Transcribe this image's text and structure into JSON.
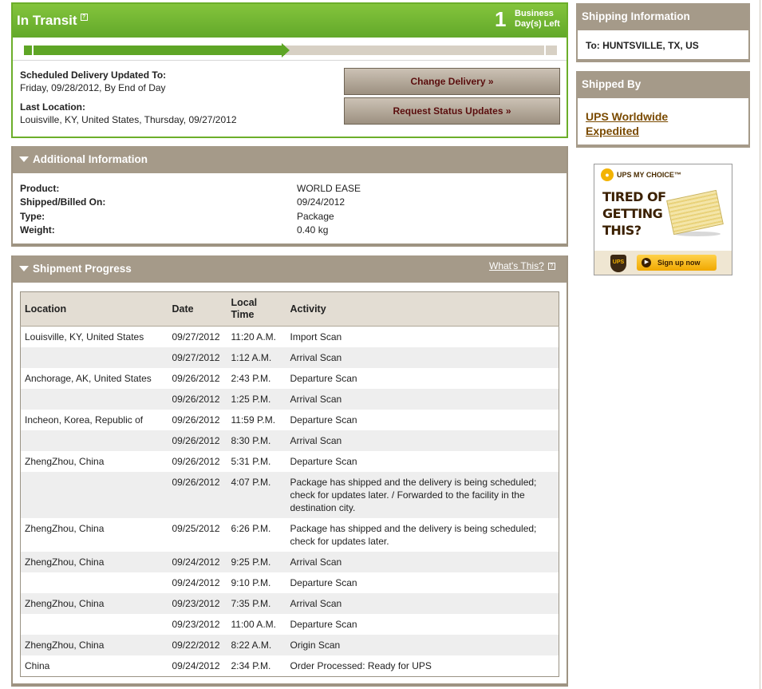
{
  "transit": {
    "title": "In Transit",
    "help_glyph": "?",
    "days_left": "1",
    "days_label_1": "Business",
    "days_label_2": "Day(s) Left",
    "progress_fraction": 0.49,
    "scheduled_label": "Scheduled Delivery Updated To:",
    "scheduled_value": "Friday, 09/28/2012, By End of Day",
    "last_location_label": "Last Location:",
    "last_location_value": "Louisville, KY, United States, Thursday, 09/27/2012",
    "change_delivery_label": "Change Delivery »",
    "request_status_label": "Request Status Updates »"
  },
  "additional_info": {
    "title": "Additional Information",
    "rows": [
      {
        "key": "Product:",
        "value": "WORLD EASE"
      },
      {
        "key": "Shipped/Billed On:",
        "value": "09/24/2012"
      },
      {
        "key": "Type:",
        "value": "Package"
      },
      {
        "key": "Weight:",
        "value": "0.40 kg"
      }
    ]
  },
  "shipment_progress": {
    "title": "Shipment Progress",
    "whats_this": "What's This?",
    "columns": [
      "Location",
      "Date",
      "Local Time",
      "Activity"
    ],
    "rows": [
      {
        "location": "Louisville, KY, United States",
        "date": "09/27/2012",
        "time": "11:20 A.M.",
        "activity": "Import Scan"
      },
      {
        "location": "",
        "date": "09/27/2012",
        "time": "1:12 A.M.",
        "activity": "Arrival Scan"
      },
      {
        "location": "Anchorage, AK, United States",
        "date": "09/26/2012",
        "time": "2:43 P.M.",
        "activity": "Departure Scan"
      },
      {
        "location": "",
        "date": "09/26/2012",
        "time": "1:25 P.M.",
        "activity": "Arrival Scan"
      },
      {
        "location": "Incheon, Korea, Republic of",
        "date": "09/26/2012",
        "time": "11:59 P.M.",
        "activity": "Departure Scan"
      },
      {
        "location": "",
        "date": "09/26/2012",
        "time": "8:30 P.M.",
        "activity": "Arrival Scan"
      },
      {
        "location": "ZhengZhou, China",
        "date": "09/26/2012",
        "time": "5:31 P.M.",
        "activity": "Departure Scan"
      },
      {
        "location": "",
        "date": "09/26/2012",
        "time": "4:07 P.M.",
        "activity": "Package has shipped and the delivery is being scheduled; check for updates later. / Forwarded to the facility in the destination city."
      },
      {
        "location": "ZhengZhou, China",
        "date": "09/25/2012",
        "time": "6:26 P.M.",
        "activity": "Package has shipped and the delivery is being scheduled; check for updates later."
      },
      {
        "location": "ZhengZhou, China",
        "date": "09/24/2012",
        "time": "9:25 P.M.",
        "activity": "Arrival Scan"
      },
      {
        "location": "",
        "date": "09/24/2012",
        "time": "9:10 P.M.",
        "activity": "Departure Scan"
      },
      {
        "location": "ZhengZhou, China",
        "date": "09/23/2012",
        "time": "7:35 P.M.",
        "activity": "Arrival Scan"
      },
      {
        "location": "",
        "date": "09/23/2012",
        "time": "11:00 A.M.",
        "activity": "Departure Scan"
      },
      {
        "location": "ZhengZhou, China",
        "date": "09/22/2012",
        "time": "8:22 A.M.",
        "activity": "Origin Scan"
      },
      {
        "location": "China",
        "date": "09/24/2012",
        "time": "2:34 P.M.",
        "activity": "Order Processed: Ready for UPS"
      }
    ]
  },
  "shipping_info": {
    "title": "Shipping Information",
    "to_line": "To:  HUNTSVILLE, TX, US"
  },
  "shipped_by": {
    "title": "Shipped By",
    "service": "UPS Worldwide Expedited"
  },
  "ad": {
    "brand": "UPS MY CHOICE™",
    "headline": "TIRED OF GETTING THIS?",
    "cta": "Sign up now",
    "shield_text": "UPS"
  },
  "colors": {
    "transit_green": "#62a82a",
    "panel_taupe": "#a59a89",
    "button_text": "#5a0d0d",
    "link_brown": "#7a4a00"
  }
}
